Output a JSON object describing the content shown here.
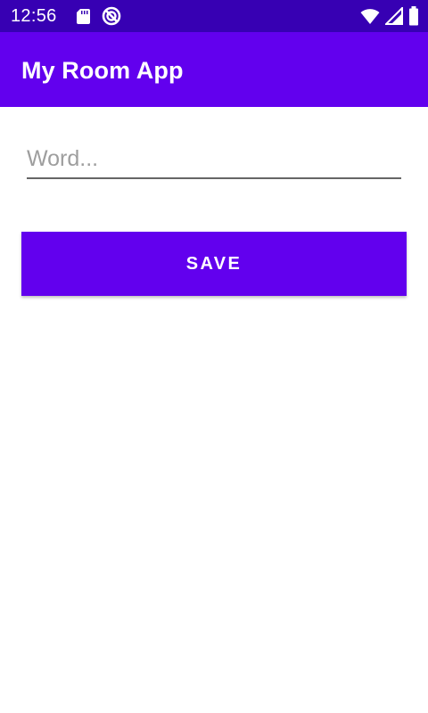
{
  "status_bar": {
    "time": "12:56",
    "icons_left": [
      "sd-card-icon",
      "sync-disabled-icon"
    ],
    "icons_right": [
      "wifi-icon",
      "cellular-signal-icon",
      "battery-icon"
    ]
  },
  "app_bar": {
    "title": "My Room App"
  },
  "form": {
    "word_field": {
      "value": "",
      "placeholder": "Word..."
    },
    "save_label": "SAVE"
  },
  "colors": {
    "status_bar": "#3700b3",
    "primary": "#6200ee",
    "on_primary": "#ffffff",
    "underline": "#666666",
    "placeholder": "#9e9e9e"
  }
}
